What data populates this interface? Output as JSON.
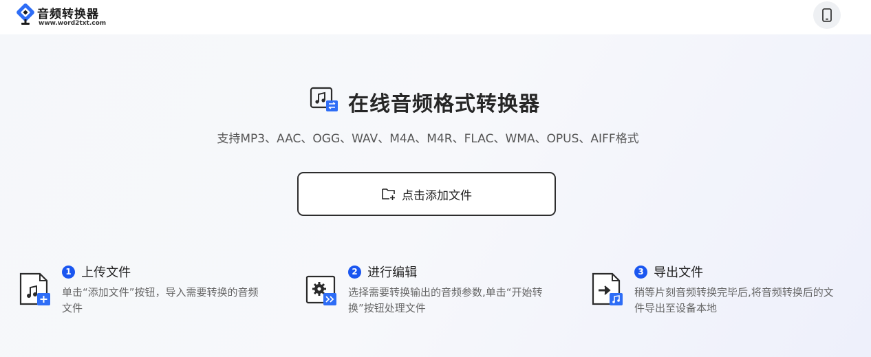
{
  "header": {
    "logo_title": "音频转换器",
    "logo_url": "www.word2txt.com",
    "phone_icon": "mobile-phone-icon"
  },
  "hero": {
    "title": "在线音频格式转换器",
    "subtitle": "支持MP3、AAC、OGG、WAV、M4A、M4R、FLAC、WMA、OPUS、AIFF格式",
    "icon": "audio-convert-icon",
    "add_button_label": "点击添加文件",
    "add_button_icon": "folder-add-icon"
  },
  "steps": [
    {
      "num": "1",
      "title": "上传文件",
      "desc": "单击“添加文件”按钮，导入需要转换的音频文件",
      "icon": "audio-file-add-icon"
    },
    {
      "num": "2",
      "title": "进行编辑",
      "desc": "选择需要转换输出的音频参数,单击“开始转换”按钮处理文件",
      "icon": "settings-file-icon"
    },
    {
      "num": "3",
      "title": "导出文件",
      "desc": "稍等片刻音频转换完毕后,将音频转换后的文件导出至设备本地",
      "icon": "export-file-icon"
    }
  ],
  "colors": {
    "accent": "#1a56f0",
    "logo_blue": "#2e6df6",
    "text_dark": "#222222",
    "text_muted": "#666666"
  }
}
